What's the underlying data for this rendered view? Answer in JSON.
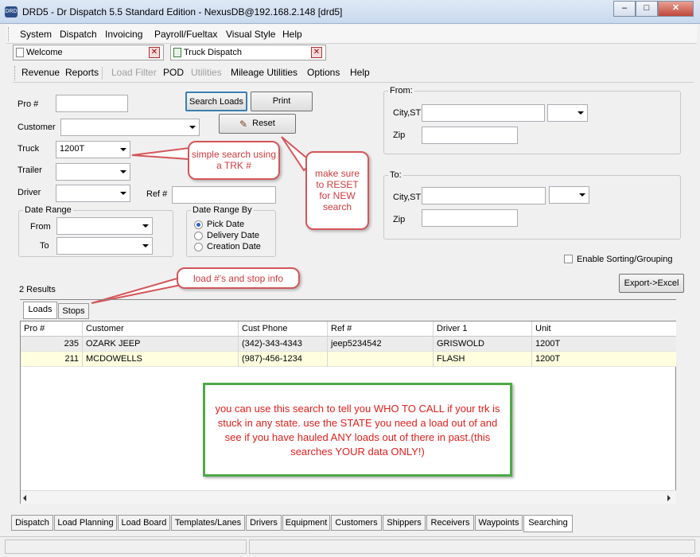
{
  "window": {
    "title": "DRD5 - Dr Dispatch 5.5 Standard Edition - NexusDB@192.168.2.148 [drd5]",
    "icon": "DRD",
    "min": "–",
    "max": "□",
    "close": "✕"
  },
  "menu": [
    "System",
    "Dispatch",
    "Invoicing",
    "Payroll/Fueltax",
    "Visual Style",
    "Help"
  ],
  "doc_tabs": [
    {
      "label": "Welcome"
    },
    {
      "label": "Truck Dispatch"
    }
  ],
  "toolbar": [
    "Revenue",
    "Reports",
    "Load Filter",
    "POD",
    "Utilities",
    "Mileage Utilities",
    "Options",
    "Help"
  ],
  "form": {
    "pro_label": "Pro #",
    "customer_label": "Customer",
    "truck_label": "Truck",
    "truck_value": "1200T",
    "trailer_label": "Trailer",
    "driver_label": "Driver",
    "ref_label": "Ref #",
    "search_btn": "Search Loads",
    "print_btn": "Print",
    "reset_btn": "Reset",
    "date_range_title": "Date Range",
    "from_label": "From",
    "to_label": "To",
    "range_by_title": "Date Range By",
    "range_by_options": [
      "Pick Date",
      "Delivery Date",
      "Creation Date"
    ],
    "range_by_selected": "Pick Date"
  },
  "from_box": {
    "title": "From:",
    "city_label": "City,ST",
    "zip_label": "Zip"
  },
  "to_box": {
    "title": "To:",
    "city_label": "City,ST",
    "zip_label": "Zip"
  },
  "enable_sorting": "Enable Sorting/Grouping",
  "export_btn": "Export->Excel",
  "results_count": "2 Results",
  "result_tabs": [
    "Loads",
    "Stops"
  ],
  "grid": {
    "columns": [
      "Pro #",
      "Customer",
      "Cust Phone",
      "Ref #",
      "Driver 1",
      "Unit"
    ],
    "rows": [
      [
        "235",
        "OZARK  JEEP",
        "(342)-343-4343",
        "jeep5234542",
        "GRISWOLD",
        "1200T"
      ],
      [
        "211",
        "MCDOWELLS",
        "(987)-456-1234",
        "",
        "FLASH",
        "1200T"
      ]
    ]
  },
  "callouts": {
    "simple_search": "simple search using a TRK #",
    "reset_note": "make sure to RESET for NEW search",
    "loads_note": "load #'s and stop info"
  },
  "note_text": "you can use this search to tell you WHO TO CALL if your trk is stuck in any state. use the STATE you need a load out of and see if you have hauled ANY loads out of there in past.(this searches YOUR data ONLY!)",
  "bottom_tabs": [
    "Dispatch",
    "Load Planning",
    "Load Board",
    "Templates/Lanes",
    "Drivers",
    "Equipment",
    "Customers",
    "Shippers",
    "Receivers",
    "Waypoints",
    "Searching"
  ],
  "colors": {
    "callout_border": "#d4565a",
    "note_border": "#4fa84a",
    "note_text": "#e0201e",
    "selected_row": "#ffffe0"
  }
}
